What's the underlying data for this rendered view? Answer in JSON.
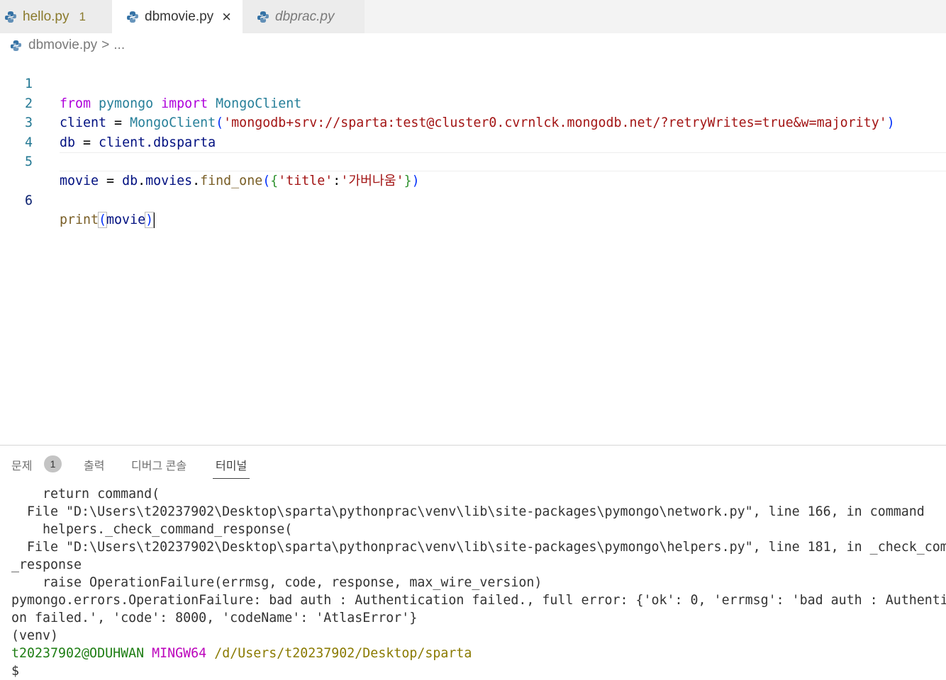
{
  "tabs": [
    {
      "label": "hello.py",
      "badge": "1"
    },
    {
      "label": "dbmovie.py",
      "close": "×"
    },
    {
      "label": "dbprac.py"
    }
  ],
  "breadcrumb": {
    "file": "dbmovie.py",
    "sep": ">",
    "ellipsis": "..."
  },
  "editor": {
    "line_numbers": [
      "1",
      "2",
      "3",
      "4",
      "5",
      "6"
    ],
    "l1": {
      "from": "from",
      "pymongo": "pymongo",
      "import": "import",
      "MongoClient": "MongoClient"
    },
    "l2": {
      "client": "client",
      "eq": " = ",
      "MongoClient": "MongoClient",
      "open": "(",
      "str": "'mongodb+srv://sparta:test@cluster0.cvrnlck.mongodb.net/?retryWrites=true&w=majority'",
      "close": ")"
    },
    "l3": {
      "db": "db",
      "eq": " = ",
      "rest": "client.dbsparta"
    },
    "l5": {
      "movie": "movie",
      "eq": " = ",
      "db": "db",
      "dot1": ".",
      "movies": "movies",
      "dot2": ".",
      "fn": "find_one",
      "p1": "(",
      "b1": "{",
      "k": "'title'",
      "colon": ":",
      "v": "'가버나움'",
      "b2": "}",
      "p2": ")"
    },
    "l6": {
      "fn": "print",
      "p1": "(",
      "arg": "movie",
      "p2": ")"
    }
  },
  "panel": {
    "tabs": [
      "문제",
      "출력",
      "디버그 콘솔",
      "터미널"
    ],
    "problems_count": "1"
  },
  "terminal": {
    "lines": [
      "    return command(",
      "  File \"D:\\Users\\t20237902\\Desktop\\sparta\\pythonprac\\venv\\lib\\site-packages\\pymongo\\network.py\", line 166, in command",
      "    helpers._check_command_response(",
      "  File \"D:\\Users\\t20237902\\Desktop\\sparta\\pythonprac\\venv\\lib\\site-packages\\pymongo\\helpers.py\", line 181, in _check_com",
      "_response",
      "    raise OperationFailure(errmsg, code, response, max_wire_version)",
      "pymongo.errors.OperationFailure: bad auth : Authentication failed., full error: {'ok': 0, 'errmsg': 'bad auth : Authenti",
      "on failed.', 'code': 8000, 'codeName': 'AtlasError'}",
      "(venv)"
    ],
    "prompt_user": "t20237902@ODUHWAN",
    "prompt_env": "MINGW64",
    "prompt_path": "/d/Users/t20237902/Desktop/sparta",
    "prompt_symbol": "$"
  },
  "colors": {
    "keyword": "#af00db",
    "string": "#a31515",
    "type": "#267f99",
    "function": "#795e26",
    "variable": "#001080",
    "prompt_green": "#1e7e14",
    "prompt_purple": "#bc05bc",
    "prompt_olive": "#8a7a00"
  },
  "icons": [
    "python-file-icon",
    "close-icon",
    "chevron-right-icon"
  ]
}
